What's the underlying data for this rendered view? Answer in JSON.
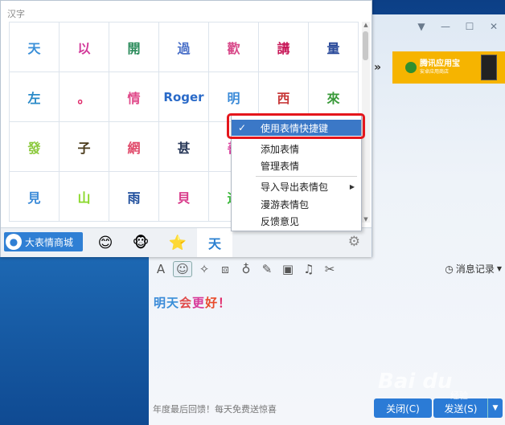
{
  "panel": {
    "title": "汉字",
    "emoticons": [
      {
        "text": "天",
        "color": "#3a8fd8"
      },
      {
        "text": "以",
        "color": "#d23a9a"
      },
      {
        "text": "開",
        "color": "#2a8a5a"
      },
      {
        "text": "過",
        "color": "#4a70c8"
      },
      {
        "text": "歡",
        "color": "#d84a8a"
      },
      {
        "text": "講",
        "color": "#c81a5a"
      },
      {
        "text": "量",
        "color": "#2a4a9a"
      },
      {
        "text": "左",
        "color": "#2a8ac8"
      },
      {
        "text": "。",
        "color": "#e02a6a"
      },
      {
        "text": "情",
        "color": "#e04a8a"
      },
      {
        "text": "Roger",
        "color": "#2a6ac8"
      },
      {
        "text": "明",
        "color": "#3a8ad8"
      },
      {
        "text": "西",
        "color": "#c83a3a"
      },
      {
        "text": "來",
        "color": "#3a9a3a"
      },
      {
        "text": "發",
        "color": "#8ac83a"
      },
      {
        "text": "子",
        "color": "#4a3a1a"
      },
      {
        "text": "網",
        "color": "#e04a6a"
      },
      {
        "text": "甚",
        "color": "#2a3a5a"
      },
      {
        "text": "善",
        "color": "#d83a9a"
      },
      {
        "text": "",
        "color": "#000"
      },
      {
        "text": "",
        "color": "#000"
      },
      {
        "text": "見",
        "color": "#3a8ad8"
      },
      {
        "text": "山",
        "color": "#8ad82a"
      },
      {
        "text": "雨",
        "color": "#1a4a9a"
      },
      {
        "text": "貝",
        "color": "#d83a8a"
      },
      {
        "text": "迎",
        "color": "#3ab83a"
      },
      {
        "text": "",
        "color": "#000"
      },
      {
        "text": "",
        "color": "#000"
      }
    ],
    "store_button": "大表情商城",
    "tabs": [
      {
        "name": "smiley",
        "glyph": "😊"
      },
      {
        "name": "monkey",
        "glyph": "🐵"
      },
      {
        "name": "star",
        "glyph": "⭐"
      },
      {
        "name": "text",
        "glyph": "天"
      }
    ]
  },
  "context_menu": {
    "items": [
      {
        "label": "使用表情快捷键",
        "checked": true,
        "submenu": false
      },
      {
        "label": "添加表情",
        "checked": false,
        "submenu": false
      },
      {
        "label": "管理表情",
        "checked": false,
        "submenu": false
      },
      {
        "label": "导入导出表情包",
        "checked": false,
        "submenu": true
      },
      {
        "label": "漫游表情包",
        "checked": false,
        "submenu": false
      },
      {
        "label": "反馈意见",
        "checked": false,
        "submenu": false
      }
    ]
  },
  "chat": {
    "ad_banner": {
      "title": "腾讯应用宝",
      "subtitle": "安卓应用商店"
    },
    "toolbar_icons": [
      "font-icon",
      "emoji-icon",
      "shake-icon",
      "screenshot-icon",
      "voice-icon",
      "edit-icon",
      "image-icon",
      "music-icon",
      "scissors-icon"
    ],
    "message_log_label": "消息记录",
    "message": [
      {
        "text": "明",
        "color": "#3a8ad8"
      },
      {
        "text": "天",
        "color": "#3a8fd8"
      },
      {
        "text": "会",
        "color": "#e04a4a"
      },
      {
        "text": "更",
        "color": "#d83a9a"
      },
      {
        "text": "好",
        "color": "#e84a2a"
      },
      {
        "text": "！",
        "color": "#e02a6a"
      }
    ],
    "footer_text": "年度最后回馈！每天免费送惊喜",
    "close_button": "关闭(C)",
    "send_button": "发送(S)"
  },
  "watermark": {
    "brand": "Bai du",
    "sub": "经验"
  }
}
